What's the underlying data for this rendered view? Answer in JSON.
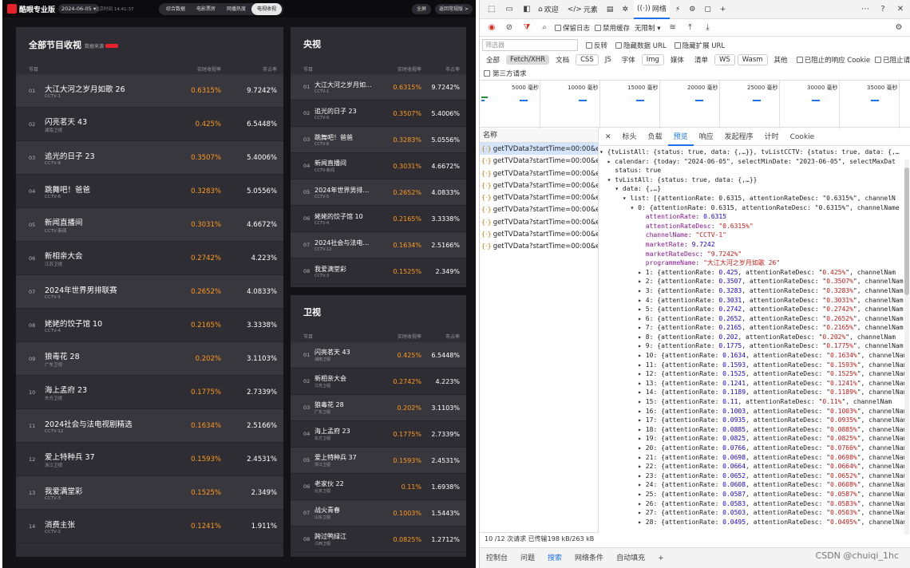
{
  "app": {
    "logo_text": "酷眼专业版",
    "date": "2024-06-05 ▾",
    "update_time": "北京时间 14:41:37",
    "nav_tabs": [
      "综合数据",
      "电影票房",
      "网播热度",
      "电视收视"
    ],
    "btn_all": "全屏",
    "btn_back": "返回常规版 >"
  },
  "panel_all": {
    "title": "全部节目收视",
    "source": "数据来源",
    "headers": {
      "program": "节目",
      "attention": "实时收视率",
      "market": "市占率"
    },
    "rows": [
      {
        "rank": "01",
        "name": "大江大河之岁月如歌 26",
        "channel": "CCTV-1",
        "att": "0.6315%",
        "mkt": "9.7242%"
      },
      {
        "rank": "02",
        "name": "闪亮茗天 43",
        "channel": "湖南卫视",
        "att": "0.425%",
        "mkt": "6.5448%"
      },
      {
        "rank": "03",
        "name": "追光的日子 23",
        "channel": "CCTV-8",
        "att": "0.3507%",
        "mkt": "5.4006%"
      },
      {
        "rank": "04",
        "name": "跳舞吧！爸爸",
        "channel": "CCTV-6",
        "att": "0.3283%",
        "mkt": "5.0556%"
      },
      {
        "rank": "05",
        "name": "新闻直播间",
        "channel": "CCTV-新闻",
        "att": "0.3031%",
        "mkt": "4.6672%"
      },
      {
        "rank": "06",
        "name": "新相亲大会",
        "channel": "江苏卫视",
        "att": "0.2742%",
        "mkt": "4.223%"
      },
      {
        "rank": "07",
        "name": "2024年世界男排联赛",
        "channel": "CCTV-5",
        "att": "0.2652%",
        "mkt": "4.0833%"
      },
      {
        "rank": "08",
        "name": "姥姥的饺子馆 10",
        "channel": "CCTV-4",
        "att": "0.2165%",
        "mkt": "3.3338%"
      },
      {
        "rank": "09",
        "name": "狼毒花 28",
        "channel": "广东卫视",
        "att": "0.202%",
        "mkt": "3.1103%"
      },
      {
        "rank": "10",
        "name": "海上孟府 23",
        "channel": "东方卫视",
        "att": "0.1775%",
        "mkt": "2.7339%"
      },
      {
        "rank": "11",
        "name": "2024社会与法电视剧精选",
        "channel": "CCTV-12",
        "att": "0.1634%",
        "mkt": "2.5166%"
      },
      {
        "rank": "12",
        "name": "爱上特种兵 37",
        "channel": "浙江卫视",
        "att": "0.1593%",
        "mkt": "2.4531%"
      },
      {
        "rank": "13",
        "name": "我爱满堂彩",
        "channel": "CCTV-3",
        "att": "0.1525%",
        "mkt": "2.349%"
      },
      {
        "rank": "14",
        "name": "消费主张",
        "channel": "CCTV-2",
        "att": "0.1241%",
        "mkt": "1.911%"
      }
    ]
  },
  "panel_cctv": {
    "title": "央视",
    "headers": {
      "program": "节目",
      "attention": "实时收视率",
      "market": "市占率"
    },
    "rows": [
      {
        "rank": "01",
        "name": "大江大河之岁月如...",
        "channel": "CCTV-1",
        "att": "0.6315%",
        "mkt": "9.7242%"
      },
      {
        "rank": "02",
        "name": "追光的日子 23",
        "channel": "CCTV-8",
        "att": "0.3507%",
        "mkt": "5.4006%"
      },
      {
        "rank": "03",
        "name": "跳舞吧！爸爸",
        "channel": "CCTV-6",
        "att": "0.3283%",
        "mkt": "5.0556%"
      },
      {
        "rank": "04",
        "name": "新闻直播间",
        "channel": "CCTV-新闻",
        "att": "0.3031%",
        "mkt": "4.6672%"
      },
      {
        "rank": "05",
        "name": "2024年世界男排联赛",
        "channel": "CCTV-5",
        "att": "0.2652%",
        "mkt": "4.0833%"
      },
      {
        "rank": "06",
        "name": "姥姥的饺子馆 10",
        "channel": "CCTV-4",
        "att": "0.2165%",
        "mkt": "3.3338%"
      },
      {
        "rank": "07",
        "name": "2024社会与法电视...",
        "channel": "CCTV-12",
        "att": "0.1634%",
        "mkt": "2.5166%"
      },
      {
        "rank": "08",
        "name": "我爱满堂彩",
        "channel": "CCTV-3",
        "att": "0.1525%",
        "mkt": "2.349%"
      }
    ]
  },
  "panel_satellite": {
    "title": "卫视",
    "headers": {
      "program": "节目",
      "attention": "实时收视率",
      "market": "市占率"
    },
    "rows": [
      {
        "rank": "01",
        "name": "闪亮茗天 43",
        "channel": "湖南卫视",
        "att": "0.425%",
        "mkt": "6.5448%"
      },
      {
        "rank": "02",
        "name": "新相亲大会",
        "channel": "江苏卫视",
        "att": "0.2742%",
        "mkt": "4.223%"
      },
      {
        "rank": "03",
        "name": "狼毒花 28",
        "channel": "广东卫视",
        "att": "0.202%",
        "mkt": "3.1103%"
      },
      {
        "rank": "04",
        "name": "海上孟府 23",
        "channel": "东方卫视",
        "att": "0.1775%",
        "mkt": "2.7339%"
      },
      {
        "rank": "05",
        "name": "爱上特种兵 37",
        "channel": "浙江卫视",
        "att": "0.1593%",
        "mkt": "2.4531%"
      },
      {
        "rank": "06",
        "name": "老家伙 22",
        "channel": "北京卫视",
        "att": "0.11%",
        "mkt": "1.6938%"
      },
      {
        "rank": "07",
        "name": "战火青春",
        "channel": "山东卫视",
        "att": "0.1003%",
        "mkt": "1.5443%"
      },
      {
        "rank": "08",
        "name": "跨过鸭绿江",
        "channel": "江西卫视",
        "att": "0.0825%",
        "mkt": "1.2712%"
      }
    ]
  },
  "devtools": {
    "top_tabs": [
      {
        "icon": "⌂",
        "label": "欢迎"
      },
      {
        "icon": "</>",
        "label": "元素"
      },
      {
        "icon": "▤",
        "label": ""
      },
      {
        "icon": "✲",
        "label": ""
      },
      {
        "icon": "((·))",
        "label": "网络"
      },
      {
        "icon": "⚡",
        "label": ""
      },
      {
        "icon": "⚙",
        "label": ""
      },
      {
        "icon": "▢",
        "label": ""
      },
      {
        "icon": "+",
        "label": ""
      }
    ],
    "toolbar": {
      "preserve_log": "保留日志",
      "disable_cache": "禁用缓存",
      "throttle": "无限制 ▾"
    },
    "filter_placeholder": "筛选器",
    "filter_opts": [
      "反转",
      "隐藏数据 URL",
      "隐藏扩展 URL"
    ],
    "types": [
      "全部",
      "Fetch/XHR",
      "文档",
      "CSS",
      "JS",
      "字体",
      "Img",
      "媒体",
      "清单",
      "WS",
      "Wasm",
      "其他"
    ],
    "blocked_cookie": "已阻止的响应 Cookie",
    "blocked_req": "已阻止请求",
    "third_party": "第三方请求",
    "timeline_labels": [
      "5000 毫秒",
      "10000 毫秒",
      "15000 毫秒",
      "20000 毫秒",
      "25000 毫秒",
      "30000 毫秒",
      "35000 毫秒"
    ],
    "name_header": "名称",
    "requests": [
      "getTVData?startTime=00:00&e...",
      "getTVData?startTime=00:00&e...",
      "getTVData?startTime=00:00&e...",
      "getTVData?startTime=00:00&e...",
      "getTVData?startTime=00:00&e...",
      "getTVData?startTime=00:00&e...",
      "getTVData?startTime=00:00&e...",
      "getTVData?startTime=00:00&e...",
      "getTVData?startTime=00:00&e..."
    ],
    "detail_tabs": [
      "标头",
      "负载",
      "预览",
      "响应",
      "发起程序",
      "计时",
      "Cookie"
    ],
    "status": "10 /12 次请求  已传输198 kB/263 kB",
    "drawer_tabs": [
      "控制台",
      "问题",
      "搜索",
      "网络条件",
      "自动填充",
      "+"
    ],
    "json_head": [
      "▾ {tvListAll: {status: true, data: {,…}}, tvListCCTV: {status: true, data: {,…",
      "  ▸ calendar: {today: \"2024-06-05\", selectMinDate: \"2023-06-05\", selectMaxDat",
      "    status: true",
      "  ▾ tvListAll: {status: true, data: {,…}}",
      "    ▾ data: {,…}",
      "      ▾ list: [{attentionRate: 0.6315, attentionRateDesc: \"0.6315%\", channelN",
      "        ▾ 0: {attentionRate: 0.6315, attentionRateDesc: \"0.6315%\", channelName"
    ],
    "json_item0": [
      {
        "k": "attentionRate",
        "v": "0.6315",
        "t": "n"
      },
      {
        "k": "attentionRateDesc",
        "v": "\"0.6315%\"",
        "t": "s"
      },
      {
        "k": "channelName",
        "v": "\"CCTV-1\"",
        "t": "s"
      },
      {
        "k": "marketRate",
        "v": "9.7242",
        "t": "n"
      },
      {
        "k": "marketRateDesc",
        "v": "\"9.7242%\"",
        "t": "s"
      },
      {
        "k": "programmeName",
        "v": "\"大江大河之岁月如歌 26\"",
        "t": "s"
      }
    ],
    "json_rest": [
      [
        "1",
        "0.425",
        "0.425%"
      ],
      [
        "2",
        "0.3507",
        "0.3507%"
      ],
      [
        "3",
        "0.3283",
        "0.3283%"
      ],
      [
        "4",
        "0.3031",
        "0.3031%"
      ],
      [
        "5",
        "0.2742",
        "0.2742%"
      ],
      [
        "6",
        "0.2652",
        "0.2652%"
      ],
      [
        "7",
        "0.2165",
        "0.2165%"
      ],
      [
        "8",
        "0.202",
        "0.202%"
      ],
      [
        "9",
        "0.1775",
        "0.1775%"
      ],
      [
        "10",
        "0.1634",
        "0.1634%"
      ],
      [
        "11",
        "0.1593",
        "0.1593%"
      ],
      [
        "12",
        "0.1525",
        "0.1525%"
      ],
      [
        "13",
        "0.1241",
        "0.1241%"
      ],
      [
        "14",
        "0.1189",
        "0.1189%"
      ],
      [
        "15",
        "0.11",
        "0.11%"
      ],
      [
        "16",
        "0.1003",
        "0.1003%"
      ],
      [
        "17",
        "0.0935",
        "0.0935%"
      ],
      [
        "18",
        "0.0885",
        "0.0885%"
      ],
      [
        "19",
        "0.0825",
        "0.0825%"
      ],
      [
        "20",
        "0.0766",
        "0.0766%"
      ],
      [
        "21",
        "0.0698",
        "0.0698%"
      ],
      [
        "22",
        "0.0664",
        "0.0664%"
      ],
      [
        "23",
        "0.0652",
        "0.0652%"
      ],
      [
        "24",
        "0.0608",
        "0.0608%"
      ],
      [
        "25",
        "0.0587",
        "0.0587%"
      ],
      [
        "26",
        "0.0583",
        "0.0583%"
      ],
      [
        "27",
        "0.0503",
        "0.0503%"
      ],
      [
        "28",
        "0.0495",
        "0.0495%"
      ]
    ],
    "watermark": "CSDN @chuiqi_1hc"
  }
}
